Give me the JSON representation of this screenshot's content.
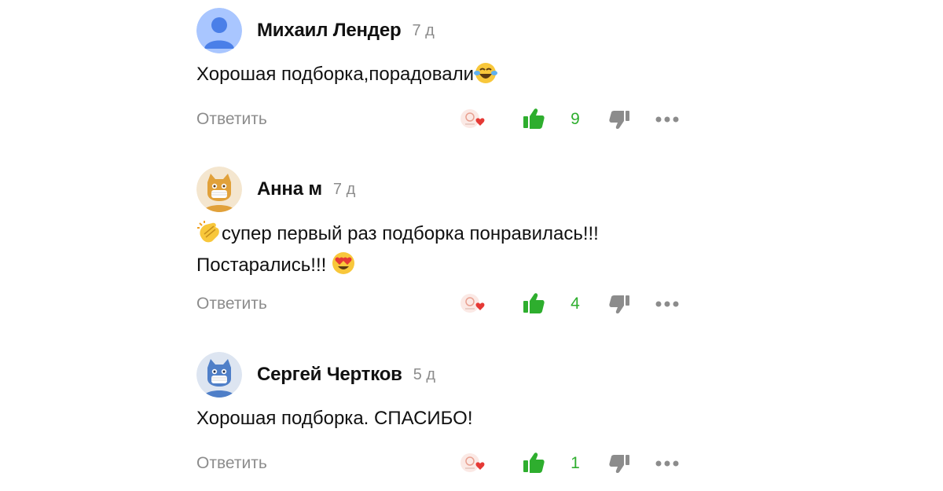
{
  "comments": [
    {
      "author": "Михаил Лендер",
      "time": "7 д",
      "text": "Хорошая подборка,порадовали",
      "text_emoji_after": "tears-of-joy-emoji",
      "reply_label": "Ответить",
      "likes": "9",
      "avatar": "default-user-avatar"
    },
    {
      "author": "Анна м",
      "time": "7 д",
      "text_emoji_before": "clapping-hands-emoji",
      "text_line1": "супер первый раз подборка понравилась!!!",
      "text_line2": "Постарались!!!",
      "text_emoji_after": "heart-eyes-emoji",
      "reply_label": "Ответить",
      "likes": "4",
      "avatar": "orange-cat-avatar"
    },
    {
      "author": "Сергей Чертков",
      "time": "5 д",
      "text": "Хорошая подборка. СПАСИБО!",
      "reply_label": "Ответить",
      "likes": "1",
      "avatar": "blue-cat-avatar"
    }
  ],
  "colors": {
    "like_green": "#2eae2e",
    "muted_text": "#8c8c8c",
    "default_avatar_bg": "#a9c6ff",
    "default_avatar_fg": "#4a7fe8",
    "orange_avatar_bg": "#f4e6cf",
    "orange_cat": "#e1a13a",
    "blue_avatar_bg": "#dde5f1",
    "blue_cat": "#4f7fc8"
  }
}
